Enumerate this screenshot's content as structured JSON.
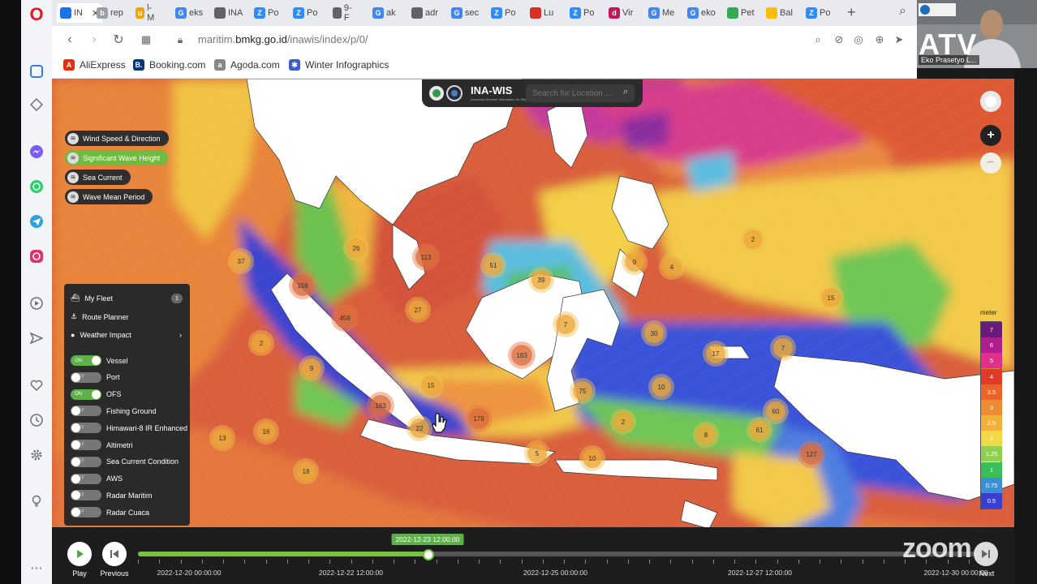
{
  "browser": {
    "tabs": [
      {
        "label": "IN",
        "fav": "globe",
        "color": "#1a73e8",
        "active": true
      },
      {
        "label": "rep",
        "fav": "b",
        "color": "#9aa0a6"
      },
      {
        "label": "l-M",
        "fav": "u",
        "color": "#f4a300"
      },
      {
        "label": "eks",
        "fav": "G",
        "color": "#4285f4"
      },
      {
        "label": "INA",
        "fav": "globe",
        "color": "#5f6368"
      },
      {
        "label": "Po",
        "fav": "Z",
        "color": "#2d8cff"
      },
      {
        "label": "Po",
        "fav": "Z",
        "color": "#2d8cff"
      },
      {
        "label": "9-F",
        "fav": "globe",
        "color": "#5f6368"
      },
      {
        "label": "ak",
        "fav": "G",
        "color": "#4285f4"
      },
      {
        "label": "adr",
        "fav": "globe",
        "color": "#5f6368"
      },
      {
        "label": "sec",
        "fav": "G",
        "color": "#4285f4"
      },
      {
        "label": "Po",
        "fav": "Z",
        "color": "#2d8cff"
      },
      {
        "label": "Lu",
        "fav": "sq",
        "color": "#d93025"
      },
      {
        "label": "Po",
        "fav": "Z",
        "color": "#2d8cff"
      },
      {
        "label": "Vir",
        "fav": "d",
        "color": "#c2185b"
      },
      {
        "label": "Me",
        "fav": "G",
        "color": "#4285f4"
      },
      {
        "label": "eko",
        "fav": "G",
        "color": "#4285f4"
      },
      {
        "label": "Pet",
        "fav": "leaf",
        "color": "#34a853"
      },
      {
        "label": "Bal",
        "fav": "drive",
        "color": "#fbbc04"
      },
      {
        "label": "Po",
        "fav": "Z",
        "color": "#2d8cff"
      }
    ],
    "url_prefix": "maritim.",
    "url_host": "bmkg.go.id",
    "url_path": "/inawis/index/p/0/",
    "bookmarks": [
      {
        "label": "AliExpress",
        "color": "#e62e04",
        "glyph": "A"
      },
      {
        "label": "Booking.com",
        "color": "#003580",
        "glyph": "B."
      },
      {
        "label": "Agoda.com",
        "color": "#888888",
        "glyph": "a"
      },
      {
        "label": "Winter Infographics",
        "color": "#3c5ec9",
        "glyph": "✱"
      }
    ]
  },
  "webcam": {
    "logo_text": "ATV",
    "caption": "Eko Prasetyo L..."
  },
  "app": {
    "title": "INA-WIS",
    "subtitle": "Indonesia Weather Information for Shipping",
    "search_placeholder": "Search for Location ..."
  },
  "layers": [
    {
      "label": "Wind Speed & Direction",
      "active": false
    },
    {
      "label": "Significant Wave Height",
      "active": true
    },
    {
      "label": "Sea Current",
      "active": false
    },
    {
      "label": "Wave Mean Period",
      "active": false
    }
  ],
  "panel": {
    "fleet_label": "My Fleet",
    "fleet_count": "1",
    "route_label": "Route Planner",
    "weather_label": "Weather Impact",
    "toggles": [
      {
        "label": "Vessel",
        "state": "ON"
      },
      {
        "label": "Port",
        "state": "OFF"
      },
      {
        "label": "OFS",
        "state": "ON"
      },
      {
        "label": "Fishing Ground",
        "state": "OFF"
      },
      {
        "label": "Himawari-8 IR Enhanced",
        "state": "OFF"
      },
      {
        "label": "Altimetri",
        "state": "OFF"
      },
      {
        "label": "Sea Current Condition",
        "state": "OFF"
      },
      {
        "label": "AWS",
        "state": "OFF"
      },
      {
        "label": "Radar Maritim",
        "state": "OFF"
      },
      {
        "label": "Radar Cuaca",
        "state": "OFF"
      }
    ]
  },
  "legend": {
    "title": "meter",
    "levels": [
      {
        "label": "7",
        "color": "#6a1b7a"
      },
      {
        "label": "6",
        "color": "#b01e8e"
      },
      {
        "label": "5",
        "color": "#e0308a"
      },
      {
        "label": "4",
        "color": "#e03a28"
      },
      {
        "label": "3.5",
        "color": "#e8642a"
      },
      {
        "label": "3",
        "color": "#ee8a30"
      },
      {
        "label": "2.5",
        "color": "#f1b13a"
      },
      {
        "label": "2",
        "color": "#f3d845"
      },
      {
        "label": "1.25",
        "color": "#8fd050"
      },
      {
        "label": "1",
        "color": "#3bbd58"
      },
      {
        "label": "0.75",
        "color": "#3a8fd8"
      },
      {
        "label": "0.5",
        "color": "#3a3fd0"
      }
    ]
  },
  "clusters": [
    "37",
    "26",
    "113",
    "51",
    "158",
    "458",
    "39",
    "27",
    "9",
    "4",
    "2",
    "15",
    "7",
    "30",
    "17",
    "7",
    "183",
    "2",
    "9",
    "15",
    "163",
    "22",
    "179",
    "75",
    "10",
    "2",
    "60",
    "61",
    "8",
    "127",
    "13",
    "16",
    "5",
    "10",
    "18"
  ],
  "timeline": {
    "current": "2022-12-23 12:00:00",
    "progress": 0.34,
    "labels": [
      "2022-12-20 00:00:00",
      "2022-12-22 12:00:00",
      "2022-12-25 00:00:00",
      "2022-12-27 12:00:00",
      "2022-12-30 00:00:00"
    ],
    "play_label": "Play",
    "previous_label": "Previous",
    "next_label": "Next"
  },
  "watermark": "zoom"
}
